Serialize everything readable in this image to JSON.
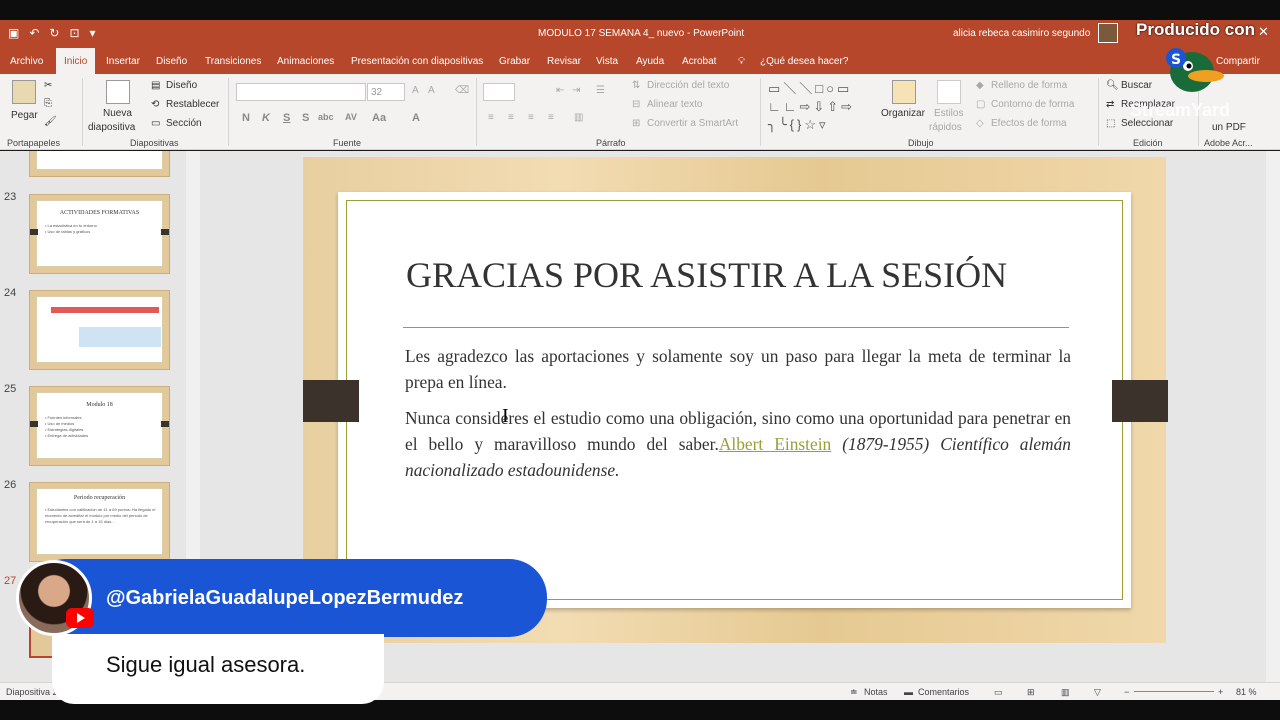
{
  "window": {
    "title": "MODULO 17 SEMANA 4_ nuevo - PowerPoint",
    "user": "alicia rebeca casimiro segundo"
  },
  "tabs": [
    "Archivo",
    "Inicio",
    "Insertar",
    "Diseño",
    "Transiciones",
    "Animaciones",
    "Presentación con diapositivas",
    "Grabar",
    "Revisar",
    "Vista",
    "Ayuda",
    "Acrobat",
    "¿Qué desea hacer?"
  ],
  "share_label": "Compartir",
  "ribbon": {
    "portapapeles": {
      "paste": "Pegar",
      "label": "Portapapeles"
    },
    "diapositivas": {
      "new": "Nueva",
      "new2": "diapositiva",
      "layout": "Diseño",
      "reset": "Restablecer",
      "section": "Sección",
      "label": "Diapositivas"
    },
    "fuente": {
      "size": "32",
      "label": "Fuente"
    },
    "parrafo": {
      "dir": "Dirección del texto",
      "align": "Alinear texto",
      "smart": "Convertir a SmartArt",
      "label": "Párrafo"
    },
    "dibujo": {
      "organize": "Organizar",
      "styles1": "Estilos",
      "styles2": "rápidos",
      "fill": "Relleno de forma",
      "outline": "Contorno de forma",
      "effects": "Efectos de forma",
      "label": "Dibujo"
    },
    "edicion": {
      "find": "Buscar",
      "replace": "Reemplazar",
      "select": "Seleccionar",
      "label": "Edición"
    },
    "adobe": {
      "pdf": "un PDF",
      "label": "Adobe Acr..."
    }
  },
  "thumbnails": [
    {
      "num": "23",
      "title": "ACTIVIDADES FORMATIVAS",
      "lines": [
        "• La estadística en tu entorno",
        "• Uso de tablas y gráficos"
      ]
    },
    {
      "num": "24",
      "title": "",
      "lines": []
    },
    {
      "num": "25",
      "title": "Modulo 18",
      "lines": [
        "• Fuentes informales",
        "• Uso de medios",
        "• Estrategias digitales",
        "• Entrega de actividades"
      ]
    },
    {
      "num": "26",
      "title": "Periodo recuperación",
      "lines": [
        "• Estudiantes con calificación de 41 a 69 puntos: Ha llegado el momento de acreditar el módulo por medio del periodo de recuperación que será de 1 a 15 días..."
      ]
    },
    {
      "num": "27",
      "title": "",
      "lines": []
    }
  ],
  "slide": {
    "title": "GRACIAS POR ASISTIR  A LA SESIÓN",
    "p1": "Les agradezco las aportaciones y solamente soy un paso para llegar la meta de terminar la prepa en línea.",
    "p2_a": "Nunca consideres el estudio como una obligación, sino como una oportunidad para penetrar en el bello y maravilloso mundo del saber.",
    "p2_link": "Albert Einstein",
    "p2_b": " (1879-1955) Científico alemán nacionalizado estadounidense."
  },
  "status": {
    "slide": "Diapositiva 27",
    "notes": "Notas",
    "comments": "Comentarios",
    "zoom": "81 %"
  },
  "overlay": {
    "producido": "Producido con",
    "streamyard": "StreamYard",
    "chat_user": "@GabrielaGuadalupeLopezBermudez",
    "chat_message": "Sigue igual asesora."
  }
}
